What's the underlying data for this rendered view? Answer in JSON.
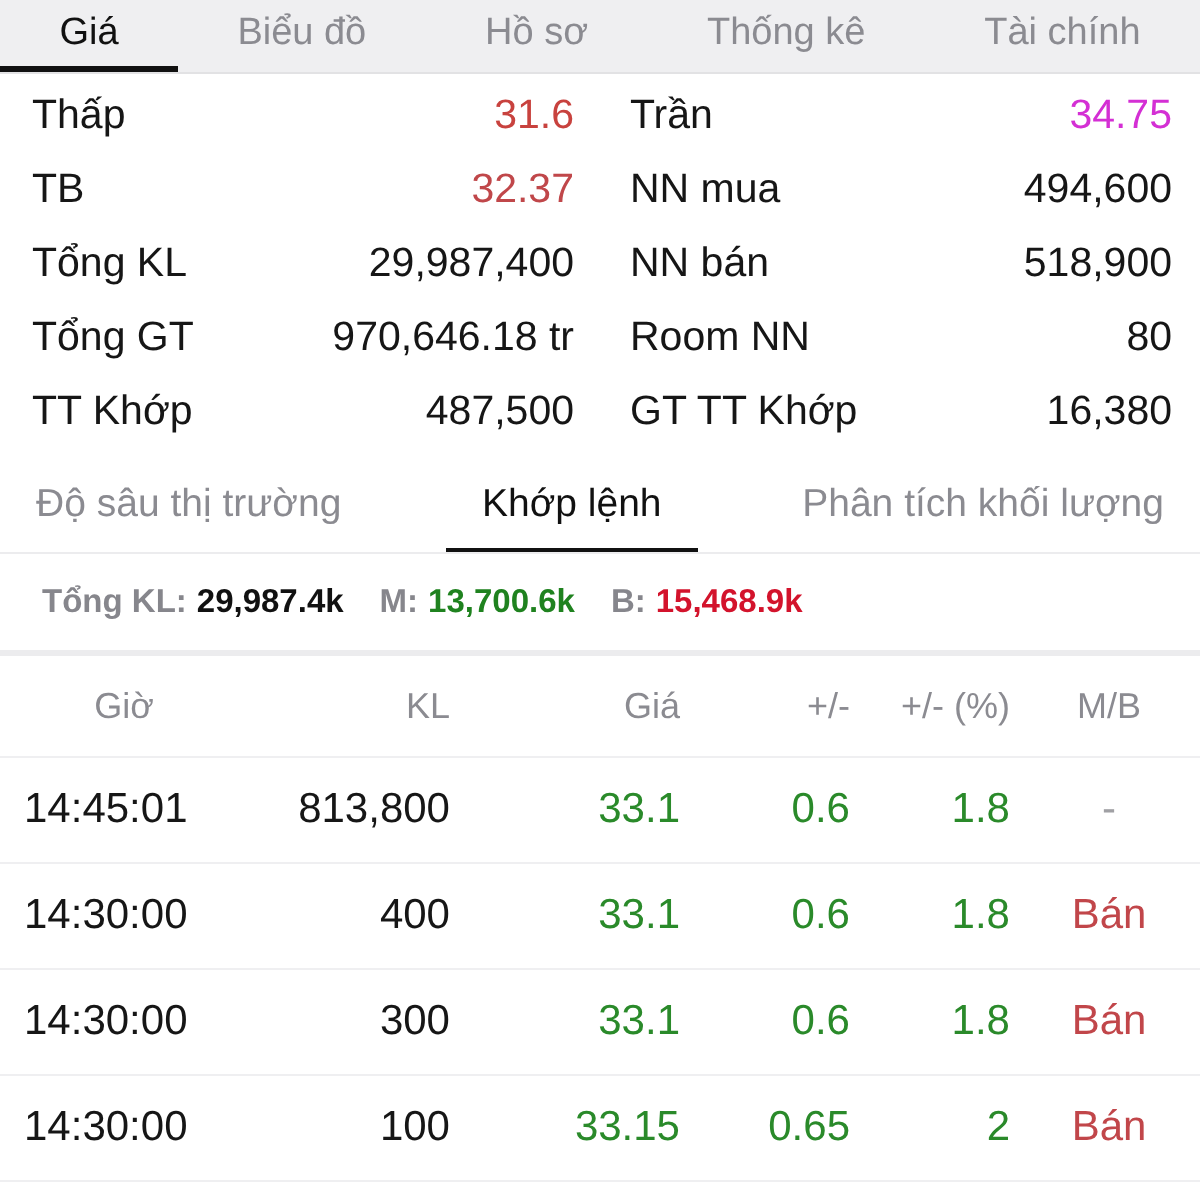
{
  "top_tabs": [
    {
      "label": "Giá",
      "selected": true
    },
    {
      "label": "Biểu đồ",
      "selected": false
    },
    {
      "label": "Hồ sơ",
      "selected": false
    },
    {
      "label": "Thống kê",
      "selected": false
    },
    {
      "label": "Tài chính",
      "selected": false
    }
  ],
  "stats": [
    {
      "label": "Thấp",
      "value": "31.6",
      "color": "#c8423e"
    },
    {
      "label": "Trần",
      "value": "34.75",
      "color": "#d42fd4"
    },
    {
      "label": "TB",
      "value": "32.37",
      "color": "#c0474a"
    },
    {
      "label": "NN mua",
      "value": "494,600",
      "color": "#161616"
    },
    {
      "label": "Tổng KL",
      "value": "29,987,400",
      "color": "#161616"
    },
    {
      "label": "NN bán",
      "value": "518,900",
      "color": "#161616"
    },
    {
      "label": "Tổng GT",
      "value": "970,646.18 tr",
      "color": "#161616"
    },
    {
      "label": "Room NN",
      "value": "80",
      "color": "#161616"
    },
    {
      "label": "TT Khớp",
      "value": "487,500",
      "color": "#161616"
    },
    {
      "label": "GT TT Khớp",
      "value": "16,380",
      "color": "#161616"
    }
  ],
  "detail_tabs": [
    {
      "label": "Độ sâu thị trường",
      "selected": false
    },
    {
      "label": "Khớp lệnh",
      "selected": true
    },
    {
      "label": "Phân tích khối lượng",
      "selected": false
    }
  ],
  "summary": [
    {
      "label": "Tổng KL:",
      "value": "29,987.4k",
      "color": "#111111"
    },
    {
      "label": "M:",
      "value": "13,700.6k",
      "color": "#1f821f"
    },
    {
      "label": "B:",
      "value": "15,468.9k",
      "color": "#d3132c"
    }
  ],
  "trades": {
    "columns": [
      "Giờ",
      "KL",
      "Giá",
      "+/-",
      "+/- (%)",
      "M/B"
    ],
    "rows": [
      {
        "time": "14:45:01",
        "volume": "813,800",
        "price": "33.1",
        "change": "0.6",
        "change_pct": "1.8",
        "color": "#2a8a2a",
        "side": {
          "text": "-",
          "kind": "none"
        }
      },
      {
        "time": "14:30:00",
        "volume": "400",
        "price": "33.1",
        "change": "0.6",
        "change_pct": "1.8",
        "color": "#2a8a2a",
        "side": {
          "text": "Bán",
          "kind": "sell"
        }
      },
      {
        "time": "14:30:00",
        "volume": "300",
        "price": "33.1",
        "change": "0.6",
        "change_pct": "1.8",
        "color": "#2a8a2a",
        "side": {
          "text": "Bán",
          "kind": "sell"
        }
      },
      {
        "time": "14:30:00",
        "volume": "100",
        "price": "33.15",
        "change": "0.65",
        "change_pct": "2",
        "color": "#2a8a2a",
        "side": {
          "text": "Bán",
          "kind": "sell"
        }
      }
    ]
  }
}
